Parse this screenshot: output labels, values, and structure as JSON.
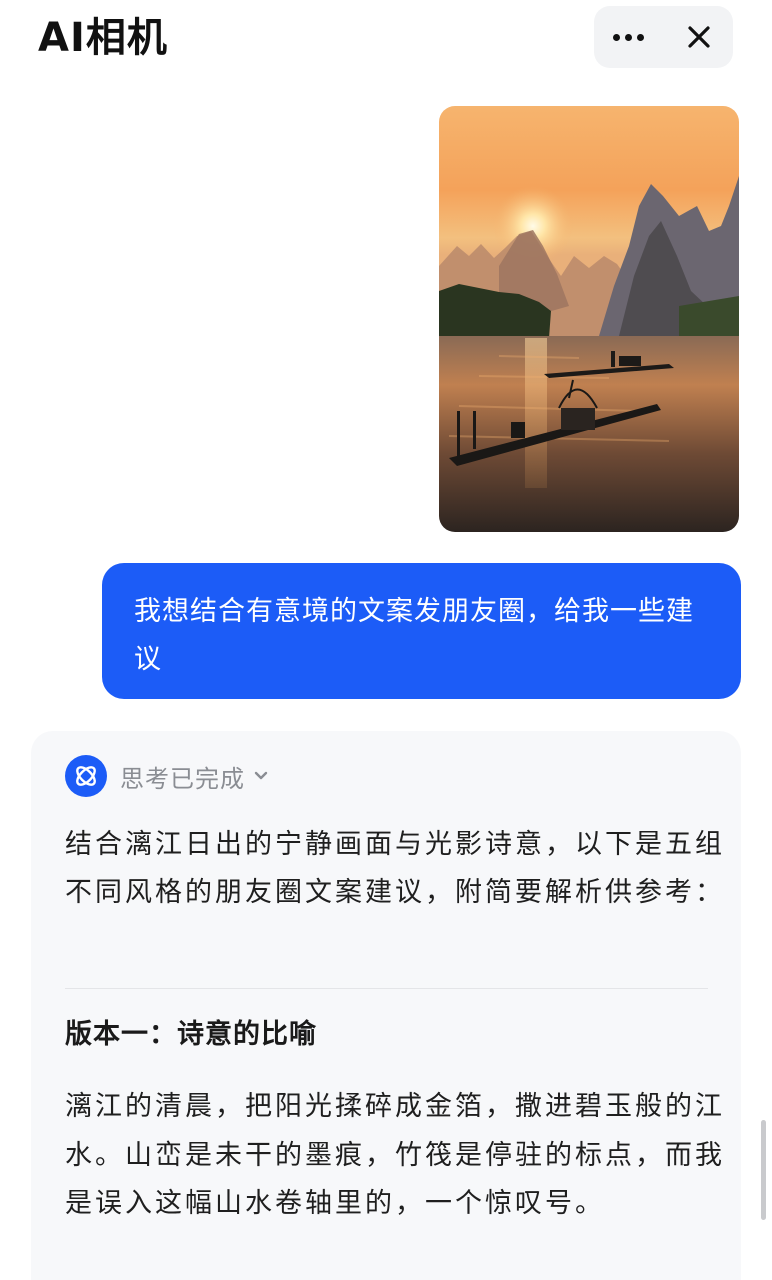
{
  "header": {
    "title": "AI相机",
    "more_icon": "more-dots-icon",
    "close_icon": "close-icon"
  },
  "conversation": {
    "user_image": {
      "icon": "photo-image"
    },
    "user_message": "我想结合有意境的文案发朋友圈，给我一些建议",
    "assistant": {
      "avatar_icon": "bot-logo-icon",
      "thinking_status": "思考已完成",
      "intro": "结合漓江日出的宁静画面与光影诗意，以下是五组不同风格的朋友圈文案建议，附简要解析供参考：",
      "version_title": "版本一：诗意的比喻",
      "version_body": "漓江的清晨，把阳光揉碎成金箔，撒进碧玉般的江水。山峦是未干的墨痕，竹筏是停驻的标点，而我是误入这幅山水卷轴里的，一个惊叹号。"
    }
  },
  "colors": {
    "accent": "#1c5cf7",
    "card_bg": "#f7f8fa",
    "muted_text": "#8a8d93"
  }
}
